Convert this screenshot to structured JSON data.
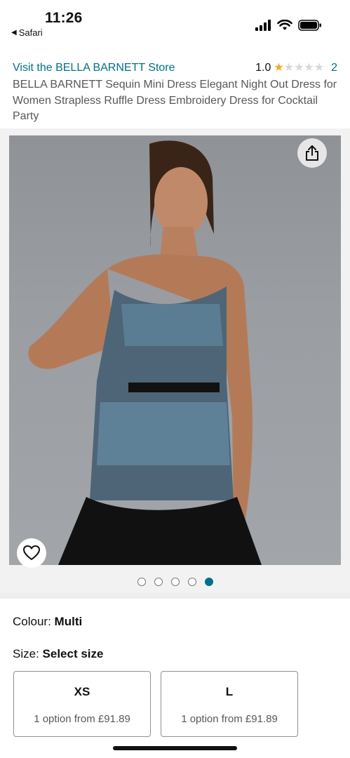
{
  "status_bar": {
    "time": "11:26",
    "back_app": "Safari",
    "icons": [
      "cellular-signal-icon",
      "wifi-icon",
      "battery-icon"
    ]
  },
  "product": {
    "store_link": "Visit the BELLA BARNETT Store",
    "rating_value": "1.0",
    "rating_stars_filled": 1,
    "rating_stars_total": 5,
    "rating_count": "2",
    "title": "BELLA BARNETT Sequin Mini Dress Elegant Night Out Dress for Women Strapless Ruffle Dress Embroidery Dress for Cocktail Party"
  },
  "gallery": {
    "image_count": 5,
    "active_index": 4,
    "share_icon": "share-icon",
    "wishlist_icon": "heart-icon"
  },
  "options": {
    "colour_label": "Colour:",
    "colour_value": "Multi",
    "size_label": "Size:",
    "size_value": "Select size",
    "sizes": [
      {
        "size": "XS",
        "option_text": "1 option from £91.89"
      },
      {
        "size": "L",
        "option_text": "1 option from £91.89"
      }
    ]
  },
  "colors": {
    "link": "#007185",
    "star": "#f5a623",
    "active_dot": "#007185"
  }
}
